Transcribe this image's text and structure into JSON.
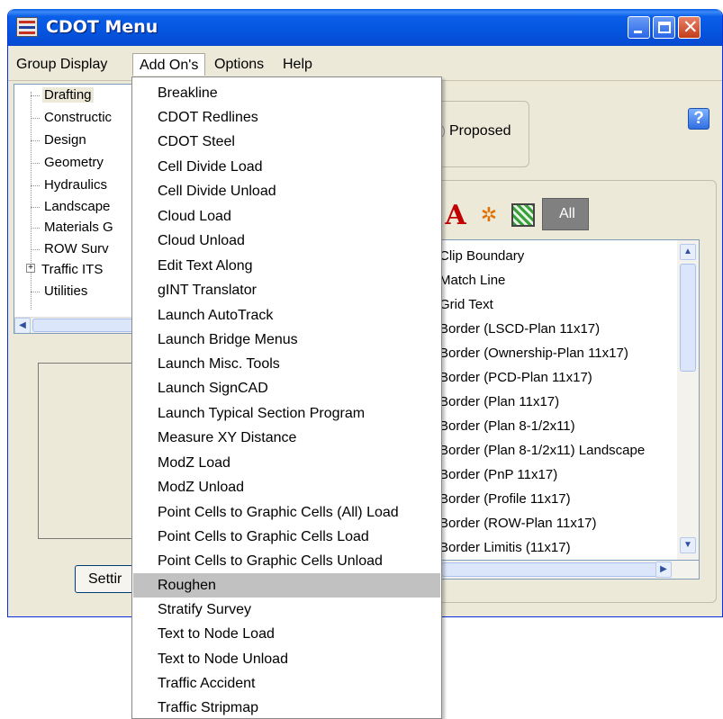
{
  "window": {
    "title": "CDOT Menu",
    "controls": [
      "minimize",
      "maximize",
      "close"
    ]
  },
  "menubar": {
    "items": [
      "Group Display",
      "Add On's",
      "Options",
      "Help"
    ],
    "active": "Add On's"
  },
  "tree": {
    "items": [
      "Drafting",
      "Constructic",
      "Design",
      "Geometry",
      "Hydraulics",
      "Landscape",
      "Materials G",
      "ROW Surv",
      "Traffic ITS",
      "Utilities"
    ],
    "selected": "Drafting",
    "expandable": "Traffic ITS"
  },
  "settings_button": {
    "label": "Settir"
  },
  "proposed": {
    "label": "Proposed"
  },
  "help_icon": {
    "glyph": "?"
  },
  "filters": {
    "text_icon": "A",
    "snap_icon": "✲",
    "all_label": "All"
  },
  "cell_list": {
    "items": [
      "Clip Boundary",
      "Match Line",
      "Grid Text",
      "Border (LSCD-Plan 11x17)",
      "Border (Ownership-Plan 11x17)",
      "Border (PCD-Plan 11x17)",
      "Border (Plan 11x17)",
      "Border (Plan 8-1/2x11)",
      "Border (Plan 8-1/2x11) Landscape",
      "Border (PnP 11x17)",
      "Border (Profile  11x17)",
      "Border (ROW-Plan 11x17)",
      "Border Limitis (11x17)"
    ]
  },
  "addons_menu": {
    "items": [
      "Breakline",
      "CDOT Redlines",
      "CDOT Steel",
      "Cell Divide Load",
      "Cell Divide Unload",
      "Cloud Load",
      "Cloud Unload",
      "Edit Text Along",
      "gINT Translator",
      "Launch AutoTrack",
      "Launch Bridge Menus",
      "Launch Misc. Tools",
      "Launch SignCAD",
      "Launch Typical Section Program",
      "Measure XY Distance",
      "ModZ Load",
      "ModZ Unload",
      "Point Cells to Graphic Cells (All) Load",
      "Point Cells to Graphic Cells Load",
      "Point Cells to Graphic Cells Unload",
      "Roughen",
      "Stratify Survey",
      "Text to Node Load",
      "Text to Node Unload",
      "Traffic Accident",
      "Traffic Stripmap"
    ],
    "highlighted": "Roughen"
  },
  "colors": {
    "titlebar": "#0555df",
    "window_bg": "#ece9d8",
    "highlight": "#c1c1c1",
    "all_button": "#808080"
  }
}
